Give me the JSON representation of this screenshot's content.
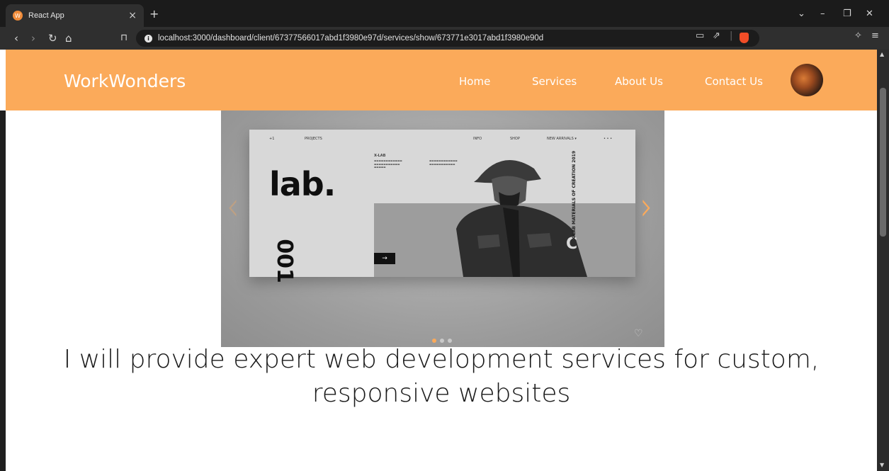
{
  "browser": {
    "tab_title": "React App",
    "url": "localhost:3000/dashboard/client/67377566017abd1f3980e97d/services/show/673771e3017abd1f3980e90d"
  },
  "site": {
    "brand": "WorkWonders",
    "nav": [
      {
        "label": "Home"
      },
      {
        "label": "Services"
      },
      {
        "label": "About Us"
      },
      {
        "label": "Contact Us"
      }
    ]
  },
  "carousel": {
    "slide_word": "lab.",
    "slide_number": "001",
    "slide_vertical_text": "X-LAB MATERIALS OF CREATION 2019",
    "top_labels": [
      "+1",
      "PROJECTS",
      "INFO",
      "SHOP",
      "NEW ARRIVALS ▾",
      "• • •"
    ],
    "small_heading": "X-LAB",
    "dots_total": 3,
    "dots_active": 0
  },
  "service": {
    "title": "I will provide expert web development services for custom, responsive websites"
  },
  "colors": {
    "accent": "#fbaa5a",
    "nav_text": "#ffffff"
  }
}
